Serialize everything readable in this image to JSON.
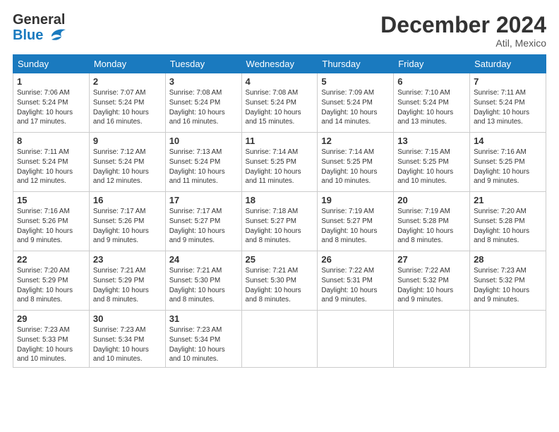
{
  "header": {
    "logo_general": "General",
    "logo_blue": "Blue",
    "month_title": "December 2024",
    "location": "Atil, Mexico"
  },
  "days_of_week": [
    "Sunday",
    "Monday",
    "Tuesday",
    "Wednesday",
    "Thursday",
    "Friday",
    "Saturday"
  ],
  "weeks": [
    [
      {
        "day": 1,
        "sunrise": "7:06 AM",
        "sunset": "5:24 PM",
        "daylight": "10 hours and 17 minutes."
      },
      {
        "day": 2,
        "sunrise": "7:07 AM",
        "sunset": "5:24 PM",
        "daylight": "10 hours and 16 minutes."
      },
      {
        "day": 3,
        "sunrise": "7:08 AM",
        "sunset": "5:24 PM",
        "daylight": "10 hours and 16 minutes."
      },
      {
        "day": 4,
        "sunrise": "7:08 AM",
        "sunset": "5:24 PM",
        "daylight": "10 hours and 15 minutes."
      },
      {
        "day": 5,
        "sunrise": "7:09 AM",
        "sunset": "5:24 PM",
        "daylight": "10 hours and 14 minutes."
      },
      {
        "day": 6,
        "sunrise": "7:10 AM",
        "sunset": "5:24 PM",
        "daylight": "10 hours and 13 minutes."
      },
      {
        "day": 7,
        "sunrise": "7:11 AM",
        "sunset": "5:24 PM",
        "daylight": "10 hours and 13 minutes."
      }
    ],
    [
      {
        "day": 8,
        "sunrise": "7:11 AM",
        "sunset": "5:24 PM",
        "daylight": "10 hours and 12 minutes."
      },
      {
        "day": 9,
        "sunrise": "7:12 AM",
        "sunset": "5:24 PM",
        "daylight": "10 hours and 12 minutes."
      },
      {
        "day": 10,
        "sunrise": "7:13 AM",
        "sunset": "5:24 PM",
        "daylight": "10 hours and 11 minutes."
      },
      {
        "day": 11,
        "sunrise": "7:14 AM",
        "sunset": "5:25 PM",
        "daylight": "10 hours and 11 minutes."
      },
      {
        "day": 12,
        "sunrise": "7:14 AM",
        "sunset": "5:25 PM",
        "daylight": "10 hours and 10 minutes."
      },
      {
        "day": 13,
        "sunrise": "7:15 AM",
        "sunset": "5:25 PM",
        "daylight": "10 hours and 10 minutes."
      },
      {
        "day": 14,
        "sunrise": "7:16 AM",
        "sunset": "5:25 PM",
        "daylight": "10 hours and 9 minutes."
      }
    ],
    [
      {
        "day": 15,
        "sunrise": "7:16 AM",
        "sunset": "5:26 PM",
        "daylight": "10 hours and 9 minutes."
      },
      {
        "day": 16,
        "sunrise": "7:17 AM",
        "sunset": "5:26 PM",
        "daylight": "10 hours and 9 minutes."
      },
      {
        "day": 17,
        "sunrise": "7:17 AM",
        "sunset": "5:27 PM",
        "daylight": "10 hours and 9 minutes."
      },
      {
        "day": 18,
        "sunrise": "7:18 AM",
        "sunset": "5:27 PM",
        "daylight": "10 hours and 8 minutes."
      },
      {
        "day": 19,
        "sunrise": "7:19 AM",
        "sunset": "5:27 PM",
        "daylight": "10 hours and 8 minutes."
      },
      {
        "day": 20,
        "sunrise": "7:19 AM",
        "sunset": "5:28 PM",
        "daylight": "10 hours and 8 minutes."
      },
      {
        "day": 21,
        "sunrise": "7:20 AM",
        "sunset": "5:28 PM",
        "daylight": "10 hours and 8 minutes."
      }
    ],
    [
      {
        "day": 22,
        "sunrise": "7:20 AM",
        "sunset": "5:29 PM",
        "daylight": "10 hours and 8 minutes."
      },
      {
        "day": 23,
        "sunrise": "7:21 AM",
        "sunset": "5:29 PM",
        "daylight": "10 hours and 8 minutes."
      },
      {
        "day": 24,
        "sunrise": "7:21 AM",
        "sunset": "5:30 PM",
        "daylight": "10 hours and 8 minutes."
      },
      {
        "day": 25,
        "sunrise": "7:21 AM",
        "sunset": "5:30 PM",
        "daylight": "10 hours and 8 minutes."
      },
      {
        "day": 26,
        "sunrise": "7:22 AM",
        "sunset": "5:31 PM",
        "daylight": "10 hours and 9 minutes."
      },
      {
        "day": 27,
        "sunrise": "7:22 AM",
        "sunset": "5:32 PM",
        "daylight": "10 hours and 9 minutes."
      },
      {
        "day": 28,
        "sunrise": "7:23 AM",
        "sunset": "5:32 PM",
        "daylight": "10 hours and 9 minutes."
      }
    ],
    [
      {
        "day": 29,
        "sunrise": "7:23 AM",
        "sunset": "5:33 PM",
        "daylight": "10 hours and 10 minutes."
      },
      {
        "day": 30,
        "sunrise": "7:23 AM",
        "sunset": "5:34 PM",
        "daylight": "10 hours and 10 minutes."
      },
      {
        "day": 31,
        "sunrise": "7:23 AM",
        "sunset": "5:34 PM",
        "daylight": "10 hours and 10 minutes."
      },
      null,
      null,
      null,
      null
    ]
  ]
}
